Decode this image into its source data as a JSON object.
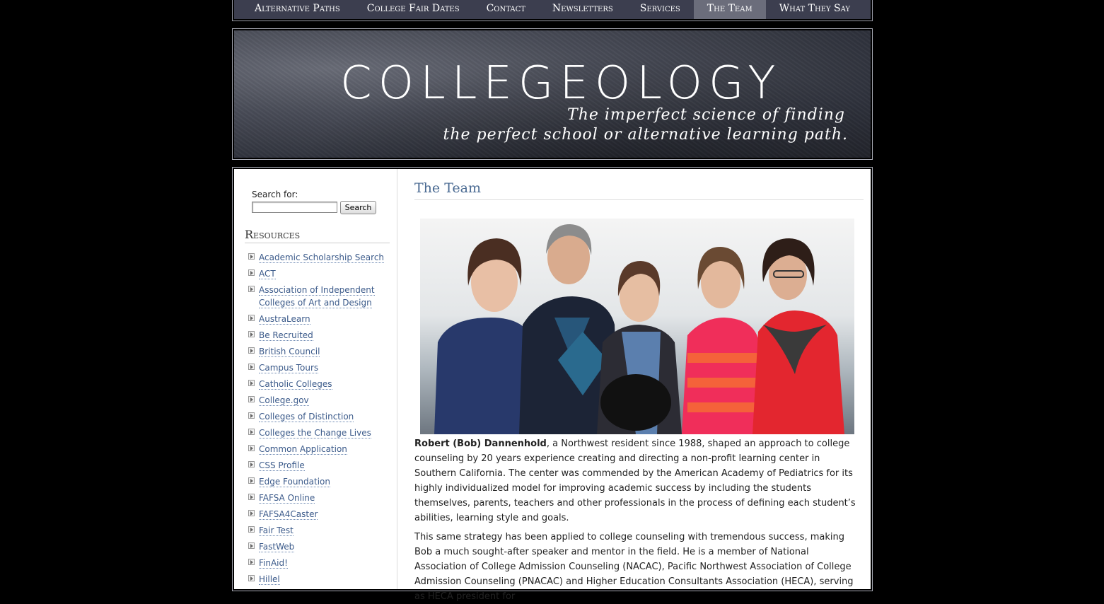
{
  "nav": {
    "items": [
      {
        "label": "Alternative Paths",
        "active": false
      },
      {
        "label": "College Fair Dates",
        "active": false
      },
      {
        "label": "Contact",
        "active": false
      },
      {
        "label": "Newsletters",
        "active": false
      },
      {
        "label": "Services",
        "active": false
      },
      {
        "label": "The Team",
        "active": true
      },
      {
        "label": "What They Say",
        "active": false
      }
    ]
  },
  "header": {
    "site_title": "COLLEGEOLOGY",
    "tagline_line1": "The imperfect science of finding",
    "tagline_line2": "the perfect school or alternative learning path."
  },
  "sidebar": {
    "search_label": "Search for:",
    "search_value": "",
    "search_button": "Search",
    "resources_heading": "Resources",
    "resources": [
      "Academic Scholarship Search",
      "ACT",
      "Association of Independent Colleges of Art and Design",
      "AustraLearn",
      "Be Recruited",
      "British Council",
      "Campus Tours",
      "Catholic Colleges",
      "College.gov",
      "Colleges of Distinction",
      "Colleges the Change Lives",
      "Common Application",
      "CSS Profile",
      "Edge Foundation",
      "FAFSA Online",
      "FAFSA4Caster",
      "Fair Test",
      "FastWeb",
      "FinAid!",
      "Hillel"
    ]
  },
  "main": {
    "page_title": "The Team",
    "photo_alt": "team photo",
    "para1_name": "Robert (Bob) Dannenhold",
    "para1_text": ", a Northwest resident since 1988, shaped an approach to college counseling by 20 years experience creating and directing a non-profit learning center in Southern California. The center was commended by the American Academy of Pediatrics for its highly individualized model for improving academic success by including the students themselves, parents, teachers and other professionals in the process of defining each student’s abilities, learning style and goals.",
    "para2_text": "This same strategy has been applied to college counseling with tremendous success, making Bob a much sought-after speaker and mentor in the field. He is a member of National Association of College Admission Counseling (NACAC), Pacific Northwest Association of College Admission Counseling (PNACAC) and Higher Education Consultants Association (HECA), serving as HECA president for"
  },
  "colors": {
    "nav_bg": "#3c3e4f",
    "nav_active": "#6b6d7b",
    "link": "#3b5a8a",
    "title": "#4a6a92"
  }
}
